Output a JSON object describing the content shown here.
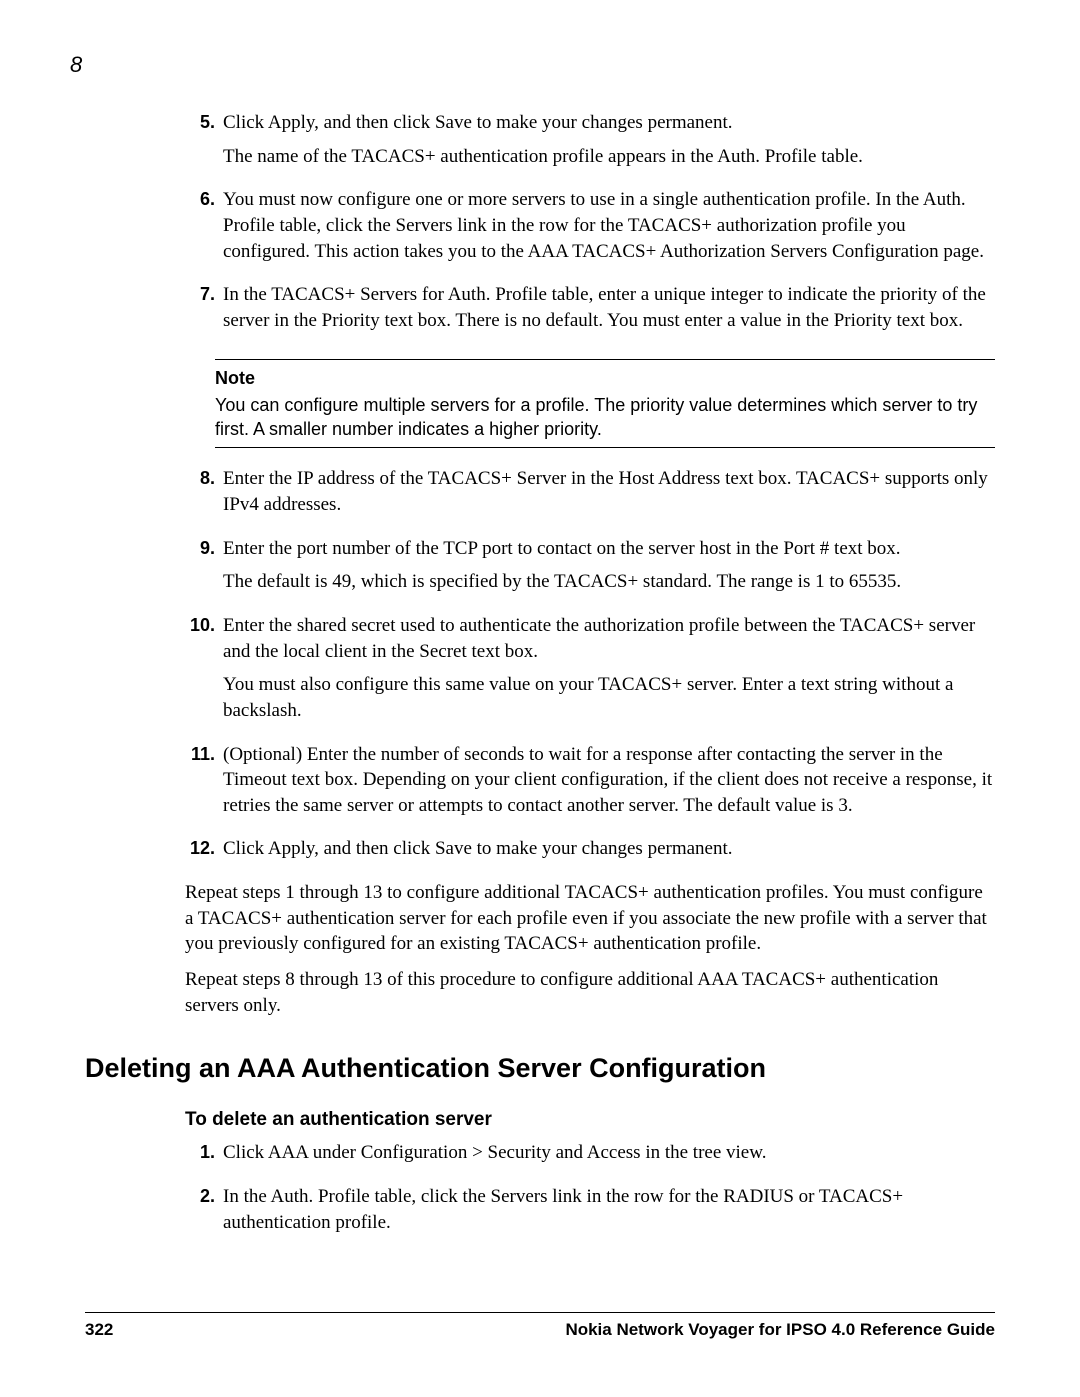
{
  "chapter": "8",
  "steps_a": [
    {
      "num": "5.",
      "paras": [
        "Click Apply, and then click Save to make your changes permanent.",
        "The name of the TACACS+ authentication profile appears in the Auth. Profile table."
      ]
    },
    {
      "num": "6.",
      "paras": [
        "You must now configure one or more servers to use in a single authentication profile. In the Auth. Profile table, click the Servers link in the row for the TACACS+ authorization profile you configured. This action takes you to the AAA TACACS+ Authorization Servers Configuration page."
      ]
    },
    {
      "num": "7.",
      "paras": [
        "In the TACACS+ Servers for Auth. Profile table, enter a unique integer to indicate the priority of the server in the Priority text box. There is no default. You must enter a value in the Priority text box."
      ]
    }
  ],
  "note": {
    "title": "Note",
    "body": "You can configure multiple servers for a profile. The priority value determines which server to try first. A smaller number indicates a higher priority."
  },
  "steps_b": [
    {
      "num": "8.",
      "paras": [
        "Enter the IP address of the TACACS+ Server in the Host Address text box. TACACS+ supports only IPv4 addresses."
      ]
    },
    {
      "num": "9.",
      "paras": [
        "Enter the port number of the TCP port to contact on the server host in the Port # text box.",
        "The default is 49, which is specified by the TACACS+ standard. The range is 1 to 65535."
      ]
    },
    {
      "num": "10.",
      "paras": [
        "Enter the shared secret used to authenticate the authorization profile between the TACACS+ server and the local client in the Secret text box.",
        "You must also configure this same value on your TACACS+ server. Enter a text string without a backslash."
      ]
    },
    {
      "num": "11.",
      "paras": [
        "(Optional) Enter the number of seconds to wait for a response after contacting the server in the Timeout text box. Depending on your client configuration, if the client does not receive a response, it retries the same server or attempts to contact another server. The default value is 3."
      ]
    },
    {
      "num": "12.",
      "paras": [
        "Click Apply, and then click Save to make your changes permanent."
      ]
    }
  ],
  "trailing_paras": [
    "Repeat steps 1 through 13 to configure additional TACACS+ authentication profiles. You must configure a TACACS+ authentication server for each profile even if you associate the new profile with a server that you previously configured for an existing TACACS+ authentication profile.",
    "Repeat steps 8 through 13 of this procedure to configure additional AAA TACACS+ authentication servers only."
  ],
  "section_heading": "Deleting an AAA Authentication Server Configuration",
  "subheading": "To delete an authentication server",
  "steps_c": [
    {
      "num": "1.",
      "paras": [
        "Click AAA under Configuration > Security and Access in the tree view."
      ]
    },
    {
      "num": "2.",
      "paras": [
        "In the Auth. Profile table, click the Servers link in the row for the RADIUS or TACACS+ authentication profile."
      ]
    }
  ],
  "footer": {
    "page_number": "322",
    "doc_title": "Nokia Network Voyager for IPSO 4.0 Reference Guide"
  }
}
